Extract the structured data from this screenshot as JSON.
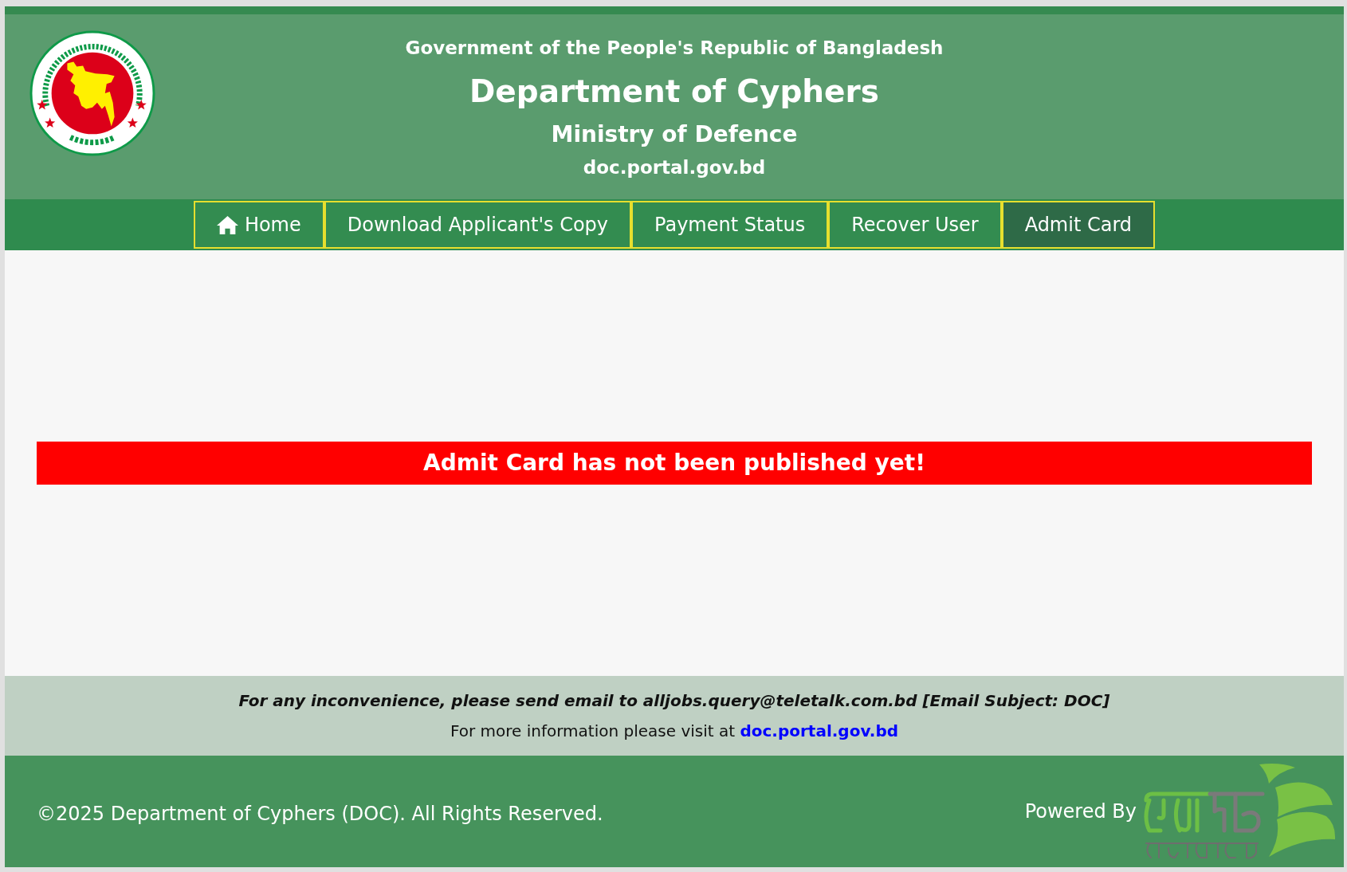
{
  "header": {
    "government": "Government of the People's Republic of Bangladesh",
    "title": "Department of Cyphers",
    "ministry": "Ministry of Defence",
    "website": "doc.portal.gov.bd"
  },
  "nav": {
    "items": [
      {
        "label": "Home",
        "kind": "with_icon",
        "selected": false
      },
      {
        "label": "Download Applicant's Copy",
        "kind": "plain",
        "selected": false
      },
      {
        "label": "Payment Status",
        "kind": "plain",
        "selected": false
      },
      {
        "label": "Recover User",
        "kind": "plain",
        "selected": false
      },
      {
        "label": "Admit Card",
        "kind": "plain",
        "selected": true
      }
    ]
  },
  "notice": {
    "text": "Admit Card has not been published yet!"
  },
  "info": {
    "contact": "For any inconvenience, please send email to alljobs.query@teletalk.com.bd [Email Subject: DOC]",
    "visit_text": "For more information please visit at",
    "visit_link": "doc.portal.gov.bd"
  },
  "footer": {
    "copyright": "©2025 Department of Cyphers (DOC). All Rights Reserved.",
    "powered_by": "Powered By"
  }
}
